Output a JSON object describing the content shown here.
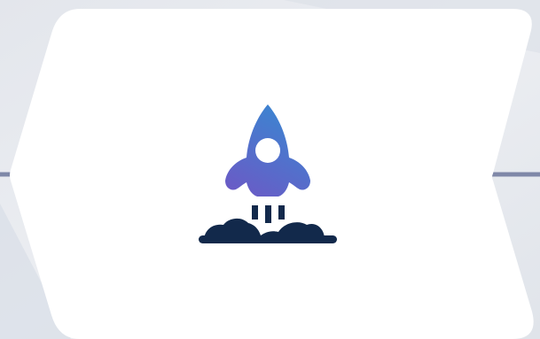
{
  "colors": {
    "background": "#e7e9ee",
    "card": "#ffffff",
    "accent_line": "#7f88a8",
    "rocket_gradient_start": "#3a86d1",
    "rocket_gradient_end": "#6a5bc6",
    "ground": "#12294b"
  },
  "icons": {
    "main": "rocket-launch-icon"
  }
}
